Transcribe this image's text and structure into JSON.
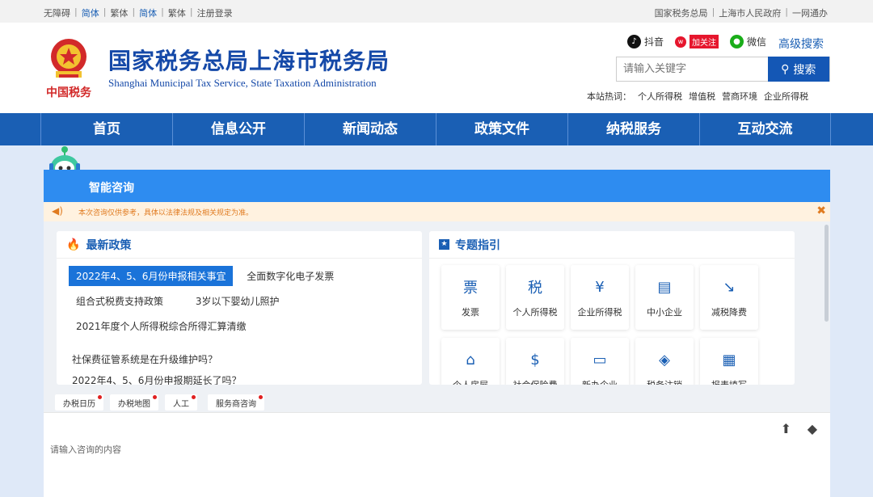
{
  "topbar": {
    "left": [
      {
        "label": "无障碍",
        "hl": false
      },
      {
        "label": "简体",
        "hl": true
      },
      {
        "label": "繁体",
        "hl": false
      },
      {
        "label": "简体",
        "hl": true
      },
      {
        "label": "繁体",
        "hl": false
      },
      {
        "label": "注册登录",
        "hl": false
      }
    ],
    "right": [
      "国家税务总局",
      "上海市人民政府",
      "一网通办"
    ]
  },
  "header": {
    "logo_text": "中国税务",
    "title_cn": "国家税务总局上海市税务局",
    "title_en": "Shanghai Municipal Tax Service, State Taxation Administration",
    "social": {
      "douyin": "抖音",
      "weibo": "加关注",
      "wechat": "微信"
    },
    "advanced_search": "高级搜索",
    "search_placeholder": "请输入关键字",
    "search_button": "搜索",
    "hot_label": "本站热词：",
    "hot_words": [
      "个人所得税",
      "增值税",
      "营商环境",
      "企业所得税"
    ]
  },
  "nav": [
    "首页",
    "信息公开",
    "新闻动态",
    "政策文件",
    "纳税服务",
    "互动交流"
  ],
  "chat": {
    "title": "智能咨询",
    "notice": "本次咨询仅供参考，具体以法律法规及相关规定为准。",
    "latest": {
      "title": "最新政策",
      "tags": [
        "2022年4、5、6月份申报相关事宜",
        "全面数字化电子发票",
        "组合式税费支持政策",
        "3岁以下婴幼儿照护",
        "2021年度个人所得税综合所得汇算清缴"
      ],
      "questions": [
        "社保费征管系统是在升级维护吗？",
        "2022年4、5、6月份申报期延长了吗？"
      ]
    },
    "topics": {
      "title": "专题指引",
      "cards": [
        {
          "label": "发票",
          "icon": "invoice-icon",
          "glyph": "票"
        },
        {
          "label": "个人所得税",
          "icon": "personal-tax-icon",
          "glyph": "税"
        },
        {
          "label": "企业所得税",
          "icon": "corporate-tax-icon",
          "glyph": "¥"
        },
        {
          "label": "中小企业",
          "icon": "sme-icon",
          "glyph": "▤"
        },
        {
          "label": "减税降费",
          "icon": "tax-cut-icon",
          "glyph": "↘"
        },
        {
          "label": "个人房屋",
          "icon": "house-icon",
          "glyph": "⌂"
        },
        {
          "label": "社会保险费",
          "icon": "social-insurance-icon",
          "glyph": "$"
        },
        {
          "label": "新办企业",
          "icon": "new-company-icon",
          "glyph": "▭"
        },
        {
          "label": "税务注销",
          "icon": "deregister-icon",
          "glyph": "◈"
        },
        {
          "label": "报表填写",
          "icon": "form-icon",
          "glyph": "▦"
        }
      ]
    },
    "quick": [
      "办税日历",
      "办税地图",
      "人工",
      "服务商咨询"
    ],
    "input_placeholder": "请输入咨询的内容"
  },
  "colors": {
    "brand": "#1a5fb4",
    "chat_header": "#2e8cf0",
    "notice_text": "#e07b20",
    "emblem_red": "#d22a2a"
  }
}
